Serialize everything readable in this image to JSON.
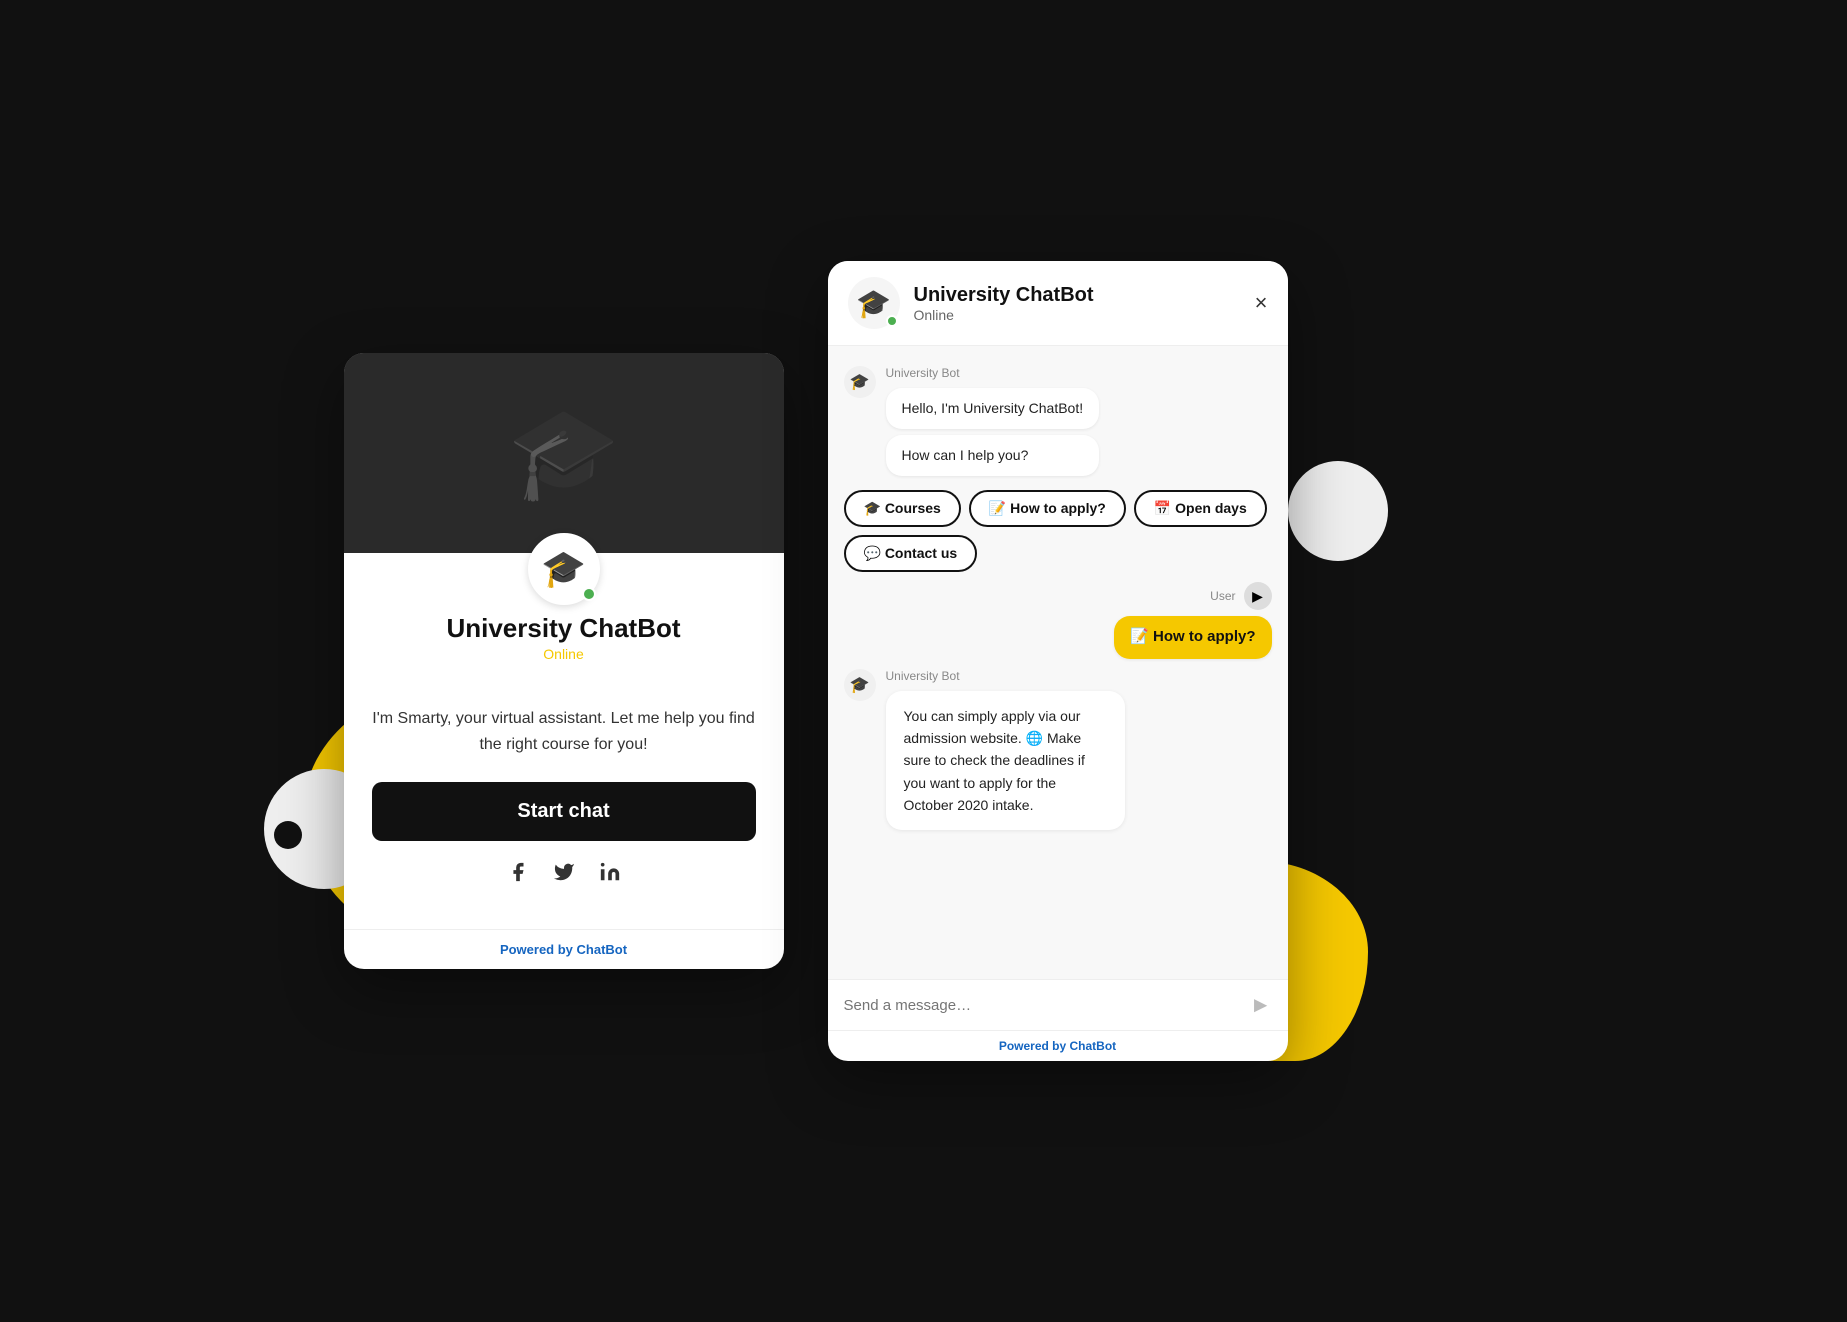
{
  "left": {
    "bot_name": "University ChatBot",
    "status": "Online",
    "intro_text": "I'm Smarty, your virtual assistant. Let me help you find the right course for you!",
    "start_chat_label": "Start chat",
    "social": [
      "f",
      "t",
      "in"
    ],
    "powered_label": "Powered by ",
    "powered_brand": "ChatBot"
  },
  "right": {
    "bot_name": "University ChatBot",
    "status": "Online",
    "close_label": "×",
    "sender_bot": "University Bot",
    "sender_user": "User",
    "messages": [
      {
        "from": "bot",
        "text": "Hello, I'm University ChatBot!"
      },
      {
        "from": "bot",
        "text": "How can I help you?"
      }
    ],
    "quick_replies": [
      {
        "label": "🎓 Courses"
      },
      {
        "label": "📝 How to apply?"
      },
      {
        "label": "📅 Open days"
      },
      {
        "label": "💬 Contact us"
      }
    ],
    "user_message": "📝 How to apply?",
    "bot_response": "You can simply apply via our admission website. 🌐 Make sure to check the deadlines if you want to apply for the October 2020 intake.",
    "input_placeholder": "Send a message…",
    "powered_label": "Powered by ",
    "powered_brand": "ChatBot"
  }
}
